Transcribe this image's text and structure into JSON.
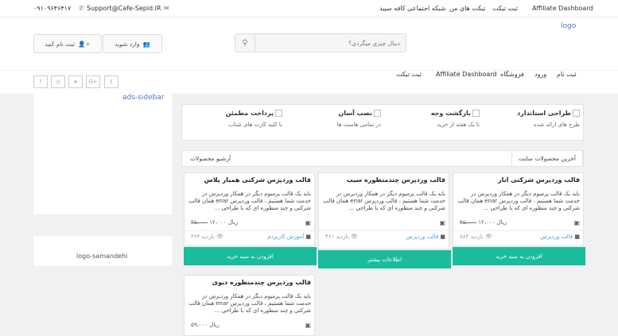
{
  "topbar": {
    "affiliate": "Affiliate Dashboard",
    "submit_ticket": "ثبت تیکت",
    "my_tickets": "تیکت های من",
    "social_network": "شبکه اجتماعی کافه سپید",
    "email": "Support@Cafe-Sepid.iR",
    "phone": "۰۹۱۰۹۶۴۶۴۱۷"
  },
  "header": {
    "logo_alt": "logo",
    "search_placeholder": "دنبال چیزی میگردی؟",
    "login_label": "وارد شوید",
    "register_label": "ثبت نام کنید"
  },
  "nav": {
    "items": [
      "ثبت نام",
      "ورود",
      "فروشگاه",
      "Affiliate Dashboard",
      "ثبت تیکت"
    ],
    "social": [
      "twitter-icon",
      "google-plus-icon",
      "telegram-icon",
      "instagram-icon",
      "facebook-icon"
    ],
    "social_glyphs": [
      "t",
      "G+",
      "➤",
      "◎",
      "f"
    ]
  },
  "sidebar": {
    "ad_alt": "ads-sidebar",
    "logo_alt": "logo-samandehi"
  },
  "features": [
    {
      "title": "طراحی استاندارد",
      "subtitle": "طرح های ارائه شده"
    },
    {
      "title": "بازگشت وجه",
      "subtitle": "تا یک هفته از خرید"
    },
    {
      "title": "نصب آسان",
      "subtitle": "در تمامی هاست ها"
    },
    {
      "title": "پرداخت مطمئن",
      "subtitle": "با کلیه کارت های شتاب"
    }
  ],
  "tabs": {
    "latest": "آخرین محصولات سایت",
    "archive": "آرشیو محصولات"
  },
  "products": [
    {
      "title": "قالب وردپرس شرکتی انار",
      "desc": "باید یک قالب پرمیوم دیگر در همکار وردپرس در خدمت شما هستیم ، قالب وردپرس enar همان قالب شرکتی و چند منظوره ای که با طراحی ...",
      "old_price": "۴۵،۰۰۰",
      "price": "ریال ۱۲،۰۰۰",
      "category": "قالب وردپرس",
      "views": "۸۸۳ بازدید",
      "button": "افزودن به سبد خرید"
    },
    {
      "title": "قالب وردپرس چندمنظوره سیب",
      "desc": "باید یک قالب پرمیوم دیگر در همکار وردپرس در خدمت شما هستیم ، قالب وردپرس enar همان قالب شرکتی و چند منظوره ای که با طراحی ...",
      "old_price": "",
      "price": "",
      "category": "قالب وردپرس",
      "views": "۴۶۱ بازدید",
      "button": "اطلاعات بیشتر"
    },
    {
      "title": "قالب وردپرس شرکتی همیار پلاس",
      "desc": "باید یک قالب پرمیوم دیگر در همکار وردپرس در خدمت شما هستیم ، قالب وردپرس enar همان قالب شرکتی و چند منظوره ای که با طراحی ...",
      "old_price": "۴۵،۰۰۰",
      "price": "ریال ۱۲،۰۰۰",
      "category": "آموزش کاربردی",
      "views": "۳۶۴ بازدید",
      "button": "افزودن به سبد خرید"
    },
    {
      "title": "قالب وردپرس چندمنظوره دیوی",
      "desc": "باید یک قالب پرمیوم دیگر در همکار وردپرس در خدمت شما هستیم ، قالب وردپرس enar همان قالب شرکتی و چند منظوره ای که با طراحی ...",
      "old_price": "",
      "price": "ریال ۵۹،۰۰۰",
      "category": "",
      "views": "",
      "button": ""
    }
  ],
  "colors": {
    "accent": "#1abc9c",
    "link": "#4aa0cf"
  }
}
